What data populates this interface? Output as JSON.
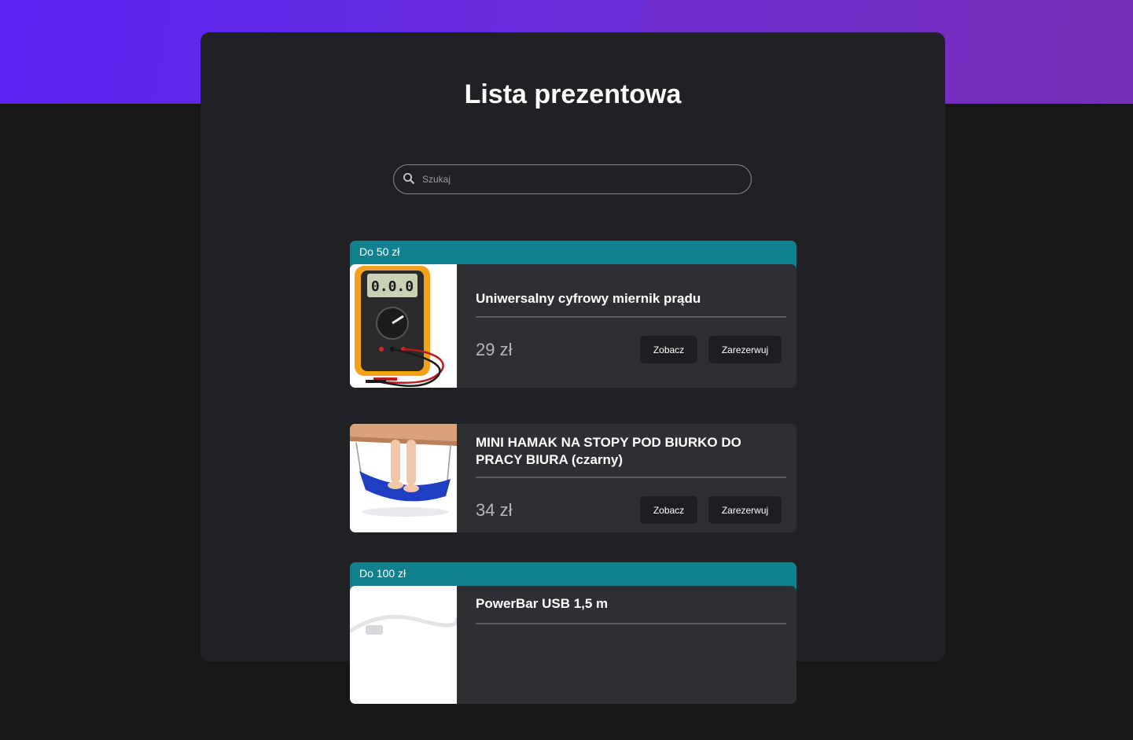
{
  "page": {
    "title": "Lista prezentowa",
    "search_placeholder": "Szukaj"
  },
  "groups": [
    {
      "label": "Do 50 zł",
      "items": [
        {
          "title": "Uniwersalny cyfrowy miernik prądu",
          "price": "29 zł",
          "view_label": "Zobacz",
          "reserve_label": "Zarezerwuj",
          "image": "digital-multimeter-image"
        },
        {
          "title": "MINI HAMAK NA STOPY POD BIURKO DO PRACY BIURA (czarny)",
          "price": "34 zł",
          "view_label": "Zobacz",
          "reserve_label": "Zarezerwuj",
          "image": "desk-foot-hammock-image"
        }
      ]
    },
    {
      "label": "Do 100 zł",
      "items": [
        {
          "title": "PowerBar USB 1,5 m",
          "image": "usb-powerbar-image"
        }
      ]
    }
  ],
  "colors": {
    "header_gradient_start": "#5b22f2",
    "header_gradient_end": "#7433b6",
    "panel": "#202124",
    "card": "#2e2f33",
    "group_header": "#11808f",
    "button": "#1d1e21"
  }
}
